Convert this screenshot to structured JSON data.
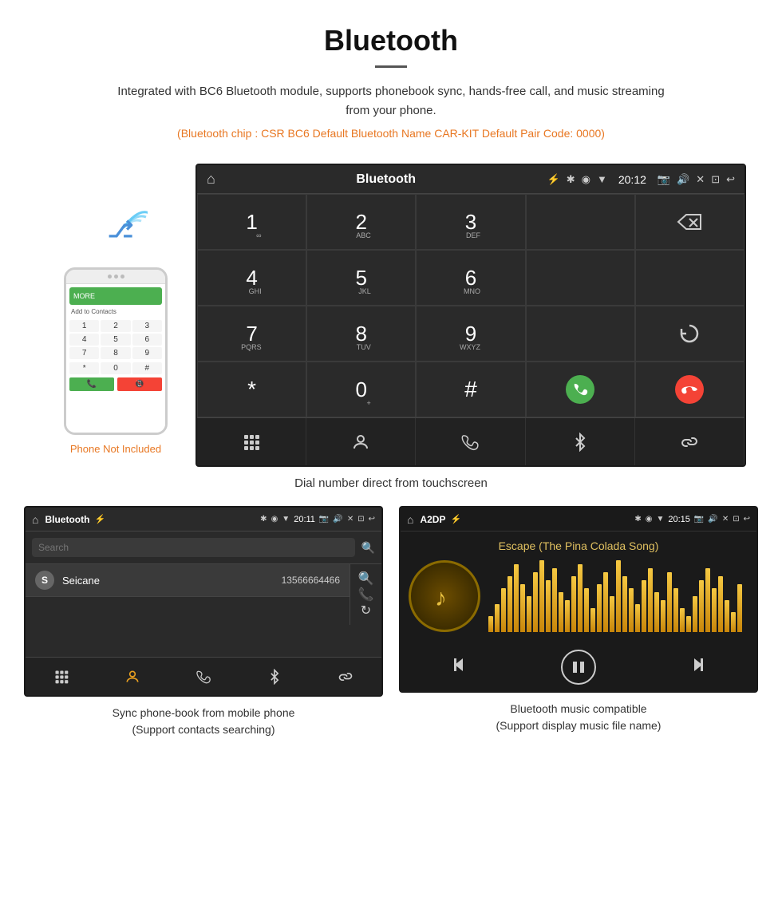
{
  "header": {
    "title": "Bluetooth",
    "description": "Integrated with BC6 Bluetooth module, supports phonebook sync, hands-free call, and music streaming from your phone.",
    "specs": "(Bluetooth chip : CSR BC6    Default Bluetooth Name CAR-KIT    Default Pair Code: 0000)"
  },
  "dial_screen": {
    "status_bar": {
      "title": "Bluetooth",
      "time": "20:12"
    },
    "keys": [
      {
        "main": "1",
        "sub": "∞"
      },
      {
        "main": "2",
        "sub": "ABC"
      },
      {
        "main": "3",
        "sub": "DEF"
      },
      {
        "main": "",
        "sub": ""
      },
      {
        "main": "⌫",
        "sub": ""
      },
      {
        "main": "4",
        "sub": "GHI"
      },
      {
        "main": "5",
        "sub": "JKL"
      },
      {
        "main": "6",
        "sub": "MNO"
      },
      {
        "main": "",
        "sub": ""
      },
      {
        "main": "",
        "sub": ""
      },
      {
        "main": "7",
        "sub": "PQRS"
      },
      {
        "main": "8",
        "sub": "TUV"
      },
      {
        "main": "9",
        "sub": "WXYZ"
      },
      {
        "main": "",
        "sub": ""
      },
      {
        "main": "↻",
        "sub": ""
      },
      {
        "main": "*",
        "sub": ""
      },
      {
        "main": "0",
        "sub": "+"
      },
      {
        "main": "#",
        "sub": ""
      },
      {
        "main": "📞",
        "sub": ""
      },
      {
        "main": "📵",
        "sub": ""
      }
    ],
    "nav_icons": [
      "⊞",
      "👤",
      "📞",
      "✱",
      "🔗"
    ]
  },
  "main_caption": "Dial number direct from touchscreen",
  "phone": {
    "not_included_label": "Phone Not Included",
    "contact_name": "Seicane",
    "add_contacts": "Add to Contacts"
  },
  "phonebook_screen": {
    "status_bar": {
      "title": "Bluetooth",
      "time": "20:11"
    },
    "search_placeholder": "Search",
    "contacts": [
      {
        "initial": "S",
        "name": "Seicane",
        "number": "13566664466"
      }
    ],
    "caption_line1": "Sync phone-book from mobile phone",
    "caption_line2": "(Support contacts searching)"
  },
  "music_screen": {
    "status_bar": {
      "title": "A2DP",
      "time": "20:15"
    },
    "song_title": "Escape (The Pina Colada Song)",
    "caption_line1": "Bluetooth music compatible",
    "caption_line2": "(Support display music file name)"
  },
  "colors": {
    "orange": "#e87722",
    "green": "#4caf50",
    "red": "#f44336",
    "dark_bg": "#2a2a2a",
    "darker_bg": "#1a1a1a"
  }
}
